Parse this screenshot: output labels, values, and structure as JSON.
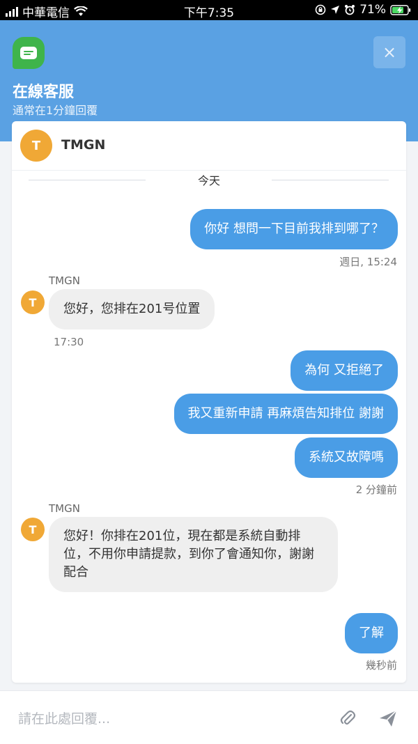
{
  "status_bar": {
    "carrier": "中華電信",
    "time": "下午7:35",
    "battery": "71%"
  },
  "header": {
    "title": "在線客服",
    "subtitle": "通常在1分鐘回覆",
    "close_label": "×"
  },
  "agent": {
    "initial": "T",
    "name": "TMGN"
  },
  "day_label": "今天",
  "messages": {
    "m1": {
      "text": "你好 想問一下目前我排到哪了？",
      "time": "週日, 15:24"
    },
    "m2": {
      "sender": "TMGN",
      "initial": "T",
      "text": "您好，您排在201号位置",
      "time": "17:30"
    },
    "m3": {
      "text": "為何 又拒絕了"
    },
    "m4": {
      "text": "我又重新申請 再麻煩告知排位 謝謝"
    },
    "m5": {
      "text": "系統又故障嗎",
      "time": "2 分鐘前"
    },
    "m6": {
      "sender": "TMGN",
      "initial": "T",
      "text": "您好！你排在201位，現在都是系統自動排位，不用你申請提款，到你了會通知你，謝謝配合"
    },
    "m7": {
      "text": "了解",
      "time": "幾秒前"
    }
  },
  "composer": {
    "placeholder": "請在此處回覆..."
  }
}
